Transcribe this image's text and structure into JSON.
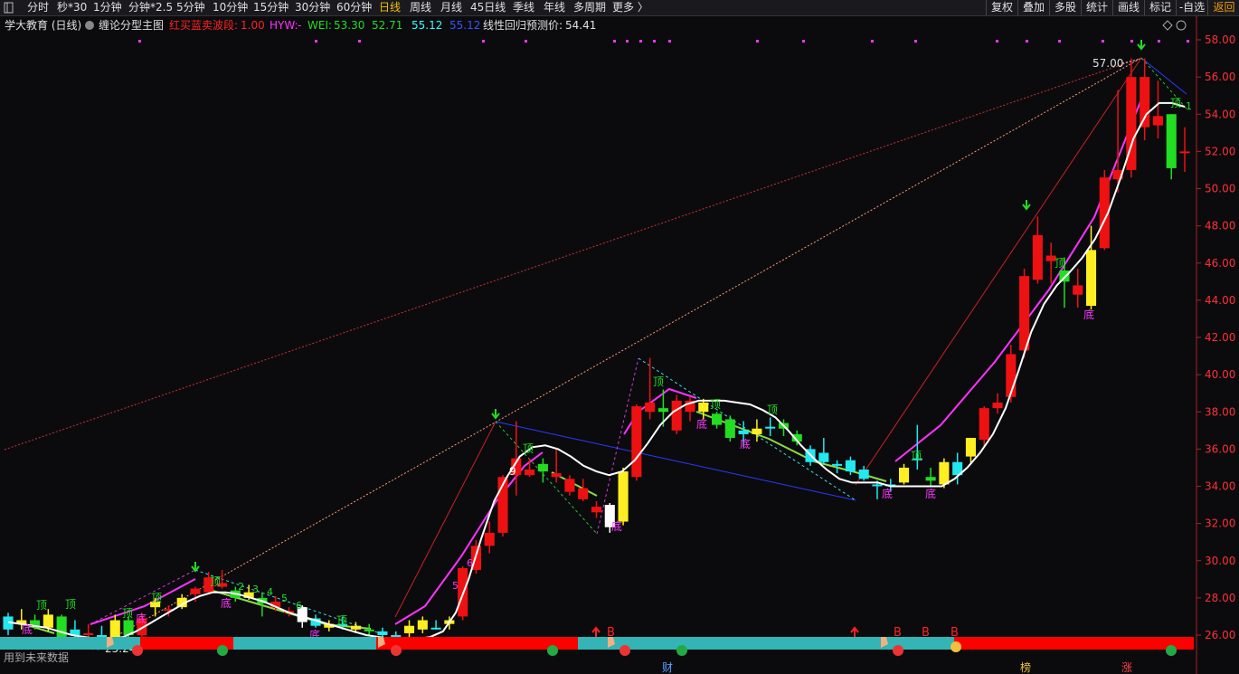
{
  "toolbar": {
    "toggle_icon": "panel-toggle-icon",
    "periods": [
      "分时",
      "秒*30",
      "1分钟",
      "分钟*2.5",
      "5分钟",
      "10分钟",
      "15分钟",
      "30分钟",
      "60分钟",
      "日线",
      "周线",
      "月线",
      "45日线",
      "季线",
      "年线",
      "多周期",
      "更多 〉"
    ],
    "active_period": "日线",
    "right_buttons": [
      "复权",
      "叠加",
      "多股",
      "统计",
      "画线",
      "标记",
      "-自选",
      "返回"
    ]
  },
  "header": {
    "stock_name": "学大教育 (日线)",
    "chart_title": "缠论分型主图",
    "indicator1_label": "红买蓝卖波段:",
    "indicator1_value": "1.00",
    "hyw_label": "HYW:",
    "hyw_value": "-",
    "wei_label": "WEI:",
    "wei_value1": "53.30",
    "wei_value2": "52.71",
    "wei_value3": "55.12",
    "wei_value4": "55.12",
    "regression_label": "线性回归预测价:",
    "regression_value": "54.41",
    "colors": {
      "red": "#ff2222",
      "magenta": "#ff33ff",
      "green": "#22dd22",
      "cyan": "#33ffff",
      "blue": "#3355ff",
      "white": "#ffffff"
    }
  },
  "price_axis": {
    "ticks": [
      "58.00",
      "56.00",
      "54.00",
      "52.00",
      "50.00",
      "48.00",
      "46.00",
      "44.00",
      "42.00",
      "40.00",
      "38.00",
      "36.00",
      "34.00",
      "32.00",
      "30.00",
      "28.00",
      "26.00"
    ]
  },
  "annotations": {
    "high_label": "57.00",
    "low_label": "25.24",
    "future_data_label": "用到未来数据",
    "ding": "顶",
    "di": "底",
    "buy": "B",
    "bottom_markers": [
      "财",
      "榜",
      "涨"
    ],
    "counts_left": [
      "2",
      "3",
      "4",
      "5",
      "6"
    ],
    "counts_mid": [
      "5",
      "6",
      "9"
    ],
    "right_one": "1"
  },
  "chart_data": {
    "type": "candlestick",
    "ylim": [
      25.2,
      58.8
    ],
    "candles": [
      {
        "o": 26.3,
        "h": 27.2,
        "l": 26.0,
        "c": 27.0,
        "col": "cyan"
      },
      {
        "o": 26.6,
        "h": 27.4,
        "l": 26.3,
        "c": 26.8,
        "col": "yellow"
      },
      {
        "o": 26.8,
        "h": 27.1,
        "l": 26.3,
        "c": 26.5,
        "col": "green"
      },
      {
        "o": 26.4,
        "h": 27.4,
        "l": 26.2,
        "c": 27.1,
        "col": "yellow"
      },
      {
        "o": 27.0,
        "h": 27.1,
        "l": 25.8,
        "c": 25.9,
        "col": "green"
      },
      {
        "o": 26.0,
        "h": 26.8,
        "l": 25.6,
        "c": 26.3,
        "col": "cyan"
      },
      {
        "o": 26.1,
        "h": 26.6,
        "l": 25.9,
        "c": 26.0,
        "col": "red"
      },
      {
        "o": 26.0,
        "h": 26.5,
        "l": 25.5,
        "c": 25.7,
        "col": "cyan"
      },
      {
        "o": 25.9,
        "h": 27.1,
        "l": 25.6,
        "c": 26.8,
        "col": "yellow"
      },
      {
        "o": 26.8,
        "h": 27.0,
        "l": 25.9,
        "c": 26.0,
        "col": "green"
      },
      {
        "o": 26.0,
        "h": 27.2,
        "l": 25.9,
        "c": 26.9,
        "col": "red"
      },
      {
        "o": 27.5,
        "h": 28.0,
        "l": 27.0,
        "c": 27.8,
        "col": "yellow"
      },
      {
        "o": 27.3,
        "h": 27.6,
        "l": 27.0,
        "c": 27.4,
        "col": "red"
      },
      {
        "o": 27.5,
        "h": 28.2,
        "l": 27.4,
        "c": 28.0,
        "col": "yellow"
      },
      {
        "o": 28.2,
        "h": 28.6,
        "l": 27.8,
        "c": 28.5,
        "col": "red"
      },
      {
        "o": 28.3,
        "h": 29.4,
        "l": 28.2,
        "c": 29.1,
        "col": "red"
      },
      {
        "o": 28.6,
        "h": 29.5,
        "l": 28.5,
        "c": 28.8,
        "col": "red"
      },
      {
        "o": 28.4,
        "h": 28.6,
        "l": 27.8,
        "c": 28.0,
        "col": "green"
      },
      {
        "o": 28.0,
        "h": 28.7,
        "l": 27.9,
        "c": 28.3,
        "col": "yellow"
      },
      {
        "o": 28.0,
        "h": 28.3,
        "l": 27.0,
        "c": 27.7,
        "col": "green"
      },
      {
        "o": 27.8,
        "h": 28.1,
        "l": 27.3,
        "c": 27.5,
        "col": "red"
      },
      {
        "o": 27.3,
        "h": 27.5,
        "l": 27.0,
        "c": 27.3,
        "col": "red"
      },
      {
        "o": 27.5,
        "h": 27.6,
        "l": 26.4,
        "c": 26.7,
        "col": "white"
      },
      {
        "o": 26.9,
        "h": 27.1,
        "l": 26.4,
        "c": 26.5,
        "col": "cyan"
      },
      {
        "o": 26.6,
        "h": 26.8,
        "l": 26.2,
        "c": 26.4,
        "col": "yellow"
      },
      {
        "o": 26.6,
        "h": 27.0,
        "l": 26.3,
        "c": 26.6,
        "col": "cyan"
      },
      {
        "o": 26.5,
        "h": 26.7,
        "l": 26.1,
        "c": 26.3,
        "col": "yellow"
      },
      {
        "o": 26.3,
        "h": 26.6,
        "l": 26.0,
        "c": 26.2,
        "col": "green"
      },
      {
        "o": 26.2,
        "h": 26.4,
        "l": 25.8,
        "c": 26.0,
        "col": "cyan"
      },
      {
        "o": 26.0,
        "h": 26.2,
        "l": 25.8,
        "c": 25.9,
        "col": "cyan"
      },
      {
        "o": 26.1,
        "h": 26.8,
        "l": 25.8,
        "c": 26.5,
        "col": "yellow"
      },
      {
        "o": 26.3,
        "h": 27.0,
        "l": 26.1,
        "c": 26.8,
        "col": "yellow"
      },
      {
        "o": 26.4,
        "h": 26.8,
        "l": 26.3,
        "c": 26.4,
        "col": "cyan"
      },
      {
        "o": 26.8,
        "h": 27.0,
        "l": 26.3,
        "c": 26.6,
        "col": "yellow"
      },
      {
        "o": 27.0,
        "h": 29.7,
        "l": 26.8,
        "c": 29.6,
        "col": "red"
      },
      {
        "o": 29.5,
        "h": 31.1,
        "l": 29.3,
        "c": 30.8,
        "col": "red"
      },
      {
        "o": 30.8,
        "h": 32.1,
        "l": 30.4,
        "c": 31.5,
        "col": "red"
      },
      {
        "o": 31.5,
        "h": 34.6,
        "l": 31.3,
        "c": 34.5,
        "col": "red"
      },
      {
        "o": 34.6,
        "h": 37.5,
        "l": 33.5,
        "c": 35.5,
        "col": "red"
      },
      {
        "o": 34.9,
        "h": 35.5,
        "l": 34.5,
        "c": 34.6,
        "col": "red"
      },
      {
        "o": 34.8,
        "h": 35.5,
        "l": 34.2,
        "c": 35.2,
        "col": "green"
      },
      {
        "o": 34.7,
        "h": 36.0,
        "l": 34.2,
        "c": 34.5,
        "col": "red"
      },
      {
        "o": 34.4,
        "h": 34.6,
        "l": 33.5,
        "c": 33.7,
        "col": "red"
      },
      {
        "o": 33.9,
        "h": 34.4,
        "l": 33.2,
        "c": 33.3,
        "col": "red"
      },
      {
        "o": 32.9,
        "h": 33.2,
        "l": 32.3,
        "c": 32.6,
        "col": "red"
      },
      {
        "o": 31.8,
        "h": 33.1,
        "l": 31.5,
        "c": 33.0,
        "col": "white"
      },
      {
        "o": 32.1,
        "h": 35.0,
        "l": 31.9,
        "c": 34.8,
        "col": "yellow"
      },
      {
        "o": 34.5,
        "h": 38.4,
        "l": 34.3,
        "c": 38.3,
        "col": "red"
      },
      {
        "o": 38.0,
        "h": 40.9,
        "l": 37.6,
        "c": 38.5,
        "col": "red"
      },
      {
        "o": 38.2,
        "h": 39.2,
        "l": 37.2,
        "c": 38.0,
        "col": "green"
      },
      {
        "o": 37.0,
        "h": 38.9,
        "l": 36.8,
        "c": 38.6,
        "col": "red"
      },
      {
        "o": 38.0,
        "h": 38.8,
        "l": 37.5,
        "c": 38.6,
        "col": "red"
      },
      {
        "o": 38.5,
        "h": 38.7,
        "l": 37.6,
        "c": 38.0,
        "col": "yellow"
      },
      {
        "o": 37.9,
        "h": 38.0,
        "l": 37.1,
        "c": 37.3,
        "col": "green"
      },
      {
        "o": 37.6,
        "h": 37.8,
        "l": 36.4,
        "c": 36.6,
        "col": "green"
      },
      {
        "o": 37.0,
        "h": 37.5,
        "l": 36.1,
        "c": 36.8,
        "col": "cyan"
      },
      {
        "o": 37.1,
        "h": 37.6,
        "l": 36.4,
        "c": 36.8,
        "col": "yellow"
      },
      {
        "o": 37.2,
        "h": 37.7,
        "l": 36.7,
        "c": 37.2,
        "col": "cyan"
      },
      {
        "o": 37.4,
        "h": 37.6,
        "l": 36.7,
        "c": 37.1,
        "col": "green"
      },
      {
        "o": 36.8,
        "h": 37.0,
        "l": 36.2,
        "c": 36.4,
        "col": "green"
      },
      {
        "o": 36.0,
        "h": 36.2,
        "l": 35.1,
        "c": 35.3,
        "col": "cyan"
      },
      {
        "o": 35.8,
        "h": 36.6,
        "l": 35.2,
        "c": 35.3,
        "col": "cyan"
      },
      {
        "o": 35.2,
        "h": 35.4,
        "l": 34.7,
        "c": 35.1,
        "col": "cyan"
      },
      {
        "o": 35.4,
        "h": 35.6,
        "l": 34.6,
        "c": 34.8,
        "col": "cyan"
      },
      {
        "o": 34.9,
        "h": 35.1,
        "l": 34.3,
        "c": 34.4,
        "col": "cyan"
      },
      {
        "o": 34.1,
        "h": 34.3,
        "l": 33.3,
        "c": 34.0,
        "col": "cyan"
      },
      {
        "o": 34.0,
        "h": 34.4,
        "l": 33.7,
        "c": 34.1,
        "col": "cyan"
      },
      {
        "o": 34.2,
        "h": 35.2,
        "l": 34.1,
        "c": 35.0,
        "col": "yellow"
      },
      {
        "o": 35.4,
        "h": 37.3,
        "l": 34.9,
        "c": 35.5,
        "col": "cyan"
      },
      {
        "o": 34.3,
        "h": 35.0,
        "l": 34.0,
        "c": 34.5,
        "col": "green"
      },
      {
        "o": 34.1,
        "h": 35.5,
        "l": 33.9,
        "c": 35.3,
        "col": "yellow"
      },
      {
        "o": 34.6,
        "h": 35.8,
        "l": 34.1,
        "c": 35.3,
        "col": "cyan"
      },
      {
        "o": 35.6,
        "h": 36.6,
        "l": 35.2,
        "c": 36.6,
        "col": "yellow"
      },
      {
        "o": 36.5,
        "h": 38.3,
        "l": 36.1,
        "c": 38.2,
        "col": "red"
      },
      {
        "o": 38.2,
        "h": 39.0,
        "l": 37.9,
        "c": 38.5,
        "col": "red"
      },
      {
        "o": 38.8,
        "h": 41.6,
        "l": 38.5,
        "c": 41.1,
        "col": "red"
      },
      {
        "o": 41.3,
        "h": 45.7,
        "l": 40.9,
        "c": 45.3,
        "col": "red"
      },
      {
        "o": 45.1,
        "h": 48.5,
        "l": 44.9,
        "c": 47.5,
        "col": "red"
      },
      {
        "o": 46.4,
        "h": 47.1,
        "l": 44.9,
        "c": 46.1,
        "col": "red"
      },
      {
        "o": 45.6,
        "h": 46.3,
        "l": 43.6,
        "c": 45.0,
        "col": "green"
      },
      {
        "o": 44.8,
        "h": 45.7,
        "l": 43.6,
        "c": 44.3,
        "col": "red"
      },
      {
        "o": 43.7,
        "h": 48.0,
        "l": 43.5,
        "c": 46.7,
        "col": "yellow"
      },
      {
        "o": 46.8,
        "h": 51.0,
        "l": 46.7,
        "c": 50.6,
        "col": "red"
      },
      {
        "o": 50.5,
        "h": 55.3,
        "l": 49.8,
        "c": 51.0,
        "col": "red"
      },
      {
        "o": 51.0,
        "h": 57.0,
        "l": 50.6,
        "c": 56.0,
        "col": "red"
      },
      {
        "o": 56.0,
        "h": 57.0,
        "l": 52.6,
        "c": 53.3,
        "col": "red"
      },
      {
        "o": 53.4,
        "h": 55.8,
        "l": 52.7,
        "c": 53.9,
        "col": "red"
      },
      {
        "o": 54.0,
        "h": 54.0,
        "l": 50.5,
        "c": 51.1,
        "col": "green"
      },
      {
        "o": 52.0,
        "h": 53.3,
        "l": 50.9,
        "c": 52.0,
        "col": "red"
      }
    ],
    "ma_line": [
      26.7,
      26.6,
      26.5,
      26.4,
      26.2,
      26.0,
      25.9,
      25.8,
      25.8,
      25.9,
      26.2,
      26.6,
      27.0,
      27.4,
      27.8,
      28.1,
      28.3,
      28.3,
      28.2,
      28.0,
      27.8,
      27.5,
      27.2,
      27.0,
      26.8,
      26.6,
      26.4,
      26.2,
      26.0,
      25.9,
      25.8,
      25.8,
      25.8,
      25.9,
      26.2,
      27.2,
      29.0,
      31.2,
      33.2,
      34.5,
      35.6,
      36.1,
      36.2,
      36.0,
      35.6,
      35.1,
      34.8,
      34.6,
      34.8,
      35.4,
      36.3,
      37.3,
      38.0,
      38.4,
      38.6,
      38.6,
      38.6,
      38.5,
      38.4,
      38.1,
      37.7,
      37.0,
      36.2,
      35.5,
      34.9,
      34.4,
      34.2,
      34.2,
      34.2,
      34.0,
      34.0,
      34.0,
      34.0,
      34.0,
      34.4,
      35.0,
      35.8,
      36.8,
      38.2,
      40.2,
      42.3,
      43.8,
      44.8,
      45.5,
      46.3,
      47.3,
      48.7,
      50.6,
      52.7,
      54.0,
      54.6,
      54.6,
      54.4
    ]
  }
}
